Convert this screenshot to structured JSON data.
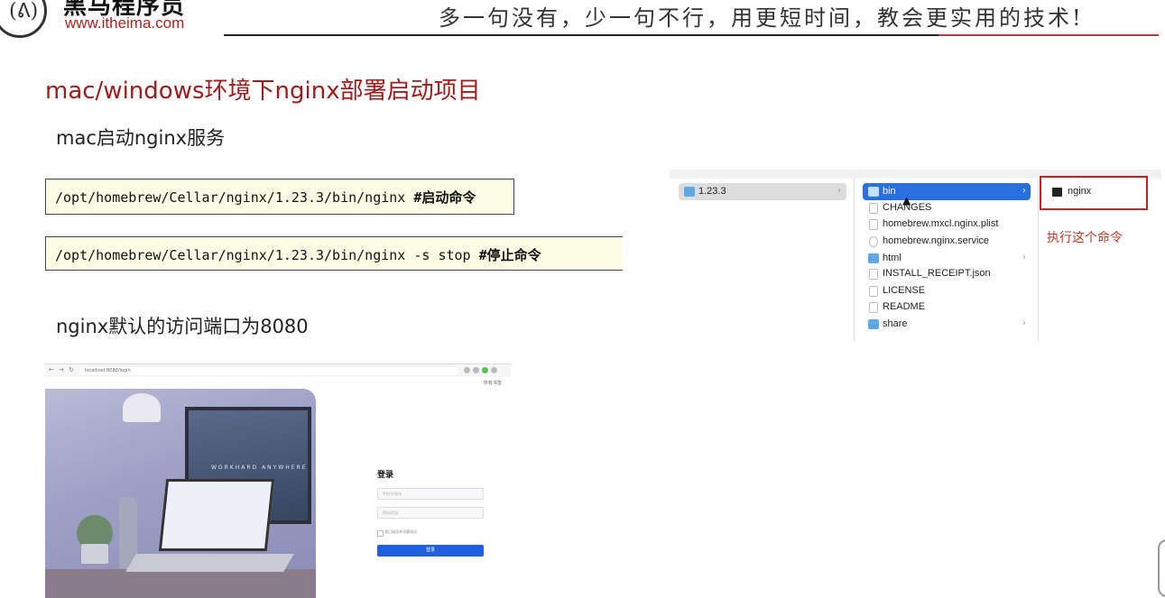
{
  "header": {
    "logo_glyph": "(ᕕ)",
    "brand_cn": "黑马程序员",
    "brand_url": "www.itheima.com",
    "slogan": "多一句没有，少一句不行，用更短时间，教会更实用的技术!"
  },
  "slide": {
    "title": "mac/windows环境下nginx部署启动项目",
    "subtitle_start": "mac启动nginx服务",
    "subtitle_port": "nginx默认的访问端口为8080"
  },
  "commands": [
    {
      "cmd": "/opt/homebrew/Cellar/nginx/1.23.3/bin/nginx ",
      "comment": "#启动命令"
    },
    {
      "cmd": "/opt/homebrew/Cellar/nginx/1.23.3/bin/nginx -s stop  ",
      "comment": "#停止命令"
    }
  ],
  "finder": {
    "col1": [
      {
        "label": "1.23.3",
        "icon": "folder-icon",
        "selected": true
      }
    ],
    "col2": [
      {
        "label": "bin",
        "icon": "folder-icon",
        "selected": true,
        "has_children": true
      },
      {
        "label": "CHANGES",
        "icon": "file-icon"
      },
      {
        "label": "homebrew.mxcl.nginx.plist",
        "icon": "file-icon"
      },
      {
        "label": "homebrew.nginx.service",
        "icon": "file-icon"
      },
      {
        "label": "html",
        "icon": "folder-icon",
        "has_children": true
      },
      {
        "label": "INSTALL_RECEIPT.json",
        "icon": "file-icon"
      },
      {
        "label": "LICENSE",
        "icon": "file-icon"
      },
      {
        "label": "README",
        "icon": "file-icon"
      },
      {
        "label": "share",
        "icon": "folder-icon",
        "has_children": true
      }
    ],
    "col3": [
      {
        "label": "nginx",
        "icon": "executable-icon"
      }
    ],
    "annotation": "执行这个命令",
    "chevron": "›"
  },
  "browser": {
    "url": "localhost:8080/login",
    "bookmark": "所有书签",
    "monitor_text": "WORKHARD ANYWHERE",
    "login": {
      "title": "登录",
      "username_placeholder": "手机号/账号",
      "password_placeholder": "密码/验证",
      "agree": "我已阅读并同意协议",
      "button": "登录"
    }
  },
  "colors": {
    "accent_red": "#a31a1a",
    "finder_blue": "#2a6fe0",
    "login_blue": "#1f5fe0",
    "cmd_bg": "#fdfde6"
  }
}
